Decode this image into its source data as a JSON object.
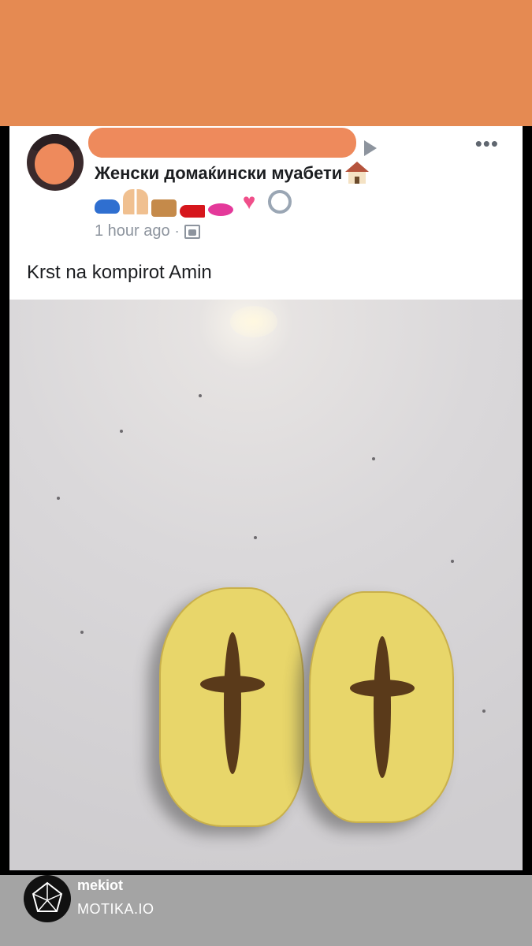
{
  "post": {
    "author_name": "",
    "group_name": "Женски домаќински муабети",
    "emoji_icons": [
      "car-icon",
      "women-holding-hands-icon",
      "handbag-icon",
      "high-heel-icon",
      "kiss-mark-icon",
      "pink-heart-icon",
      "ring-icon"
    ],
    "timestamp": "1 hour ago",
    "separator": "·",
    "heart_glyph": "♥",
    "text": "Krst na kompirot Amin",
    "more_glyph": "•••"
  },
  "watermark": {
    "username": "mekiot",
    "site": "MOTIKA.IO"
  },
  "colors": {
    "top_band": "#e58a52",
    "redaction": "#ee8a5c",
    "footer": "#a4a4a4"
  }
}
